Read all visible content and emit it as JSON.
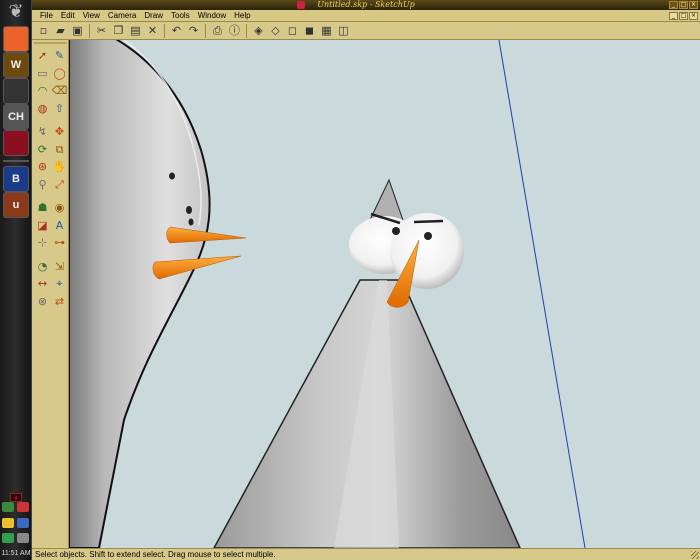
{
  "window": {
    "title": "Untitled.skp - SketchUp"
  },
  "menu": [
    "File",
    "Edit",
    "View",
    "Camera",
    "Draw",
    "Tools",
    "Window",
    "Help"
  ],
  "top_toolbar": [
    "new-icon",
    "open-icon",
    "save-icon",
    "cut-icon",
    "copy-icon",
    "paste-icon",
    "erase-icon",
    "undo-icon",
    "redo-icon",
    "print-icon",
    "model-info-icon",
    "iso-view-icon",
    "wireframe-icon",
    "hidden-line-icon",
    "shaded-icon",
    "shaded-texture-icon",
    "xray-icon"
  ],
  "left_toolbar": [
    "select-icon",
    "pencil-icon",
    "rectangle-icon",
    "circle-icon",
    "arc-icon",
    "eraser-icon",
    "paint-bucket-icon",
    "push-pull-icon",
    "follow-me-icon",
    "move-icon",
    "rotate-icon",
    "offset-icon",
    "orbit-icon",
    "pan-icon",
    "zoom-icon",
    "zoom-extents-icon",
    "walk-icon",
    "look-around-icon",
    "section-plane-icon",
    "text-icon",
    "axes-icon",
    "tape-measure-icon",
    "protractor-icon",
    "scale-icon",
    "dimension-icon",
    "position-camera-icon",
    "intersect-icon",
    "flip-icon"
  ],
  "taskbar": {
    "buttons": [
      {
        "name": "firefox-icon",
        "label": "",
        "color": "#e8642a"
      },
      {
        "name": "warcraft-icon",
        "label": "W",
        "color": "#6b4a10"
      },
      {
        "name": "app-icon-3",
        "label": "",
        "color": "#333333"
      },
      {
        "name": "ch-icon",
        "label": "CH",
        "color": "#555555"
      },
      {
        "name": "app-icon-5",
        "label": "",
        "color": "#8a1020"
      },
      {
        "name": "app-icon-6",
        "label": "B",
        "color": "#1a3a8a"
      },
      {
        "name": "app-icon-7",
        "label": "u",
        "color": "#8a3a1a"
      }
    ],
    "clock": "11:51 AM"
  },
  "status": {
    "text": "Select objects. Shift to extend select. Drag mouse to select multiple."
  },
  "colors": {
    "chrome": "#d7c98a",
    "sky": "#c9d9dc",
    "carrot": "#f58a10",
    "blue_axis": "#1f3fb0"
  }
}
